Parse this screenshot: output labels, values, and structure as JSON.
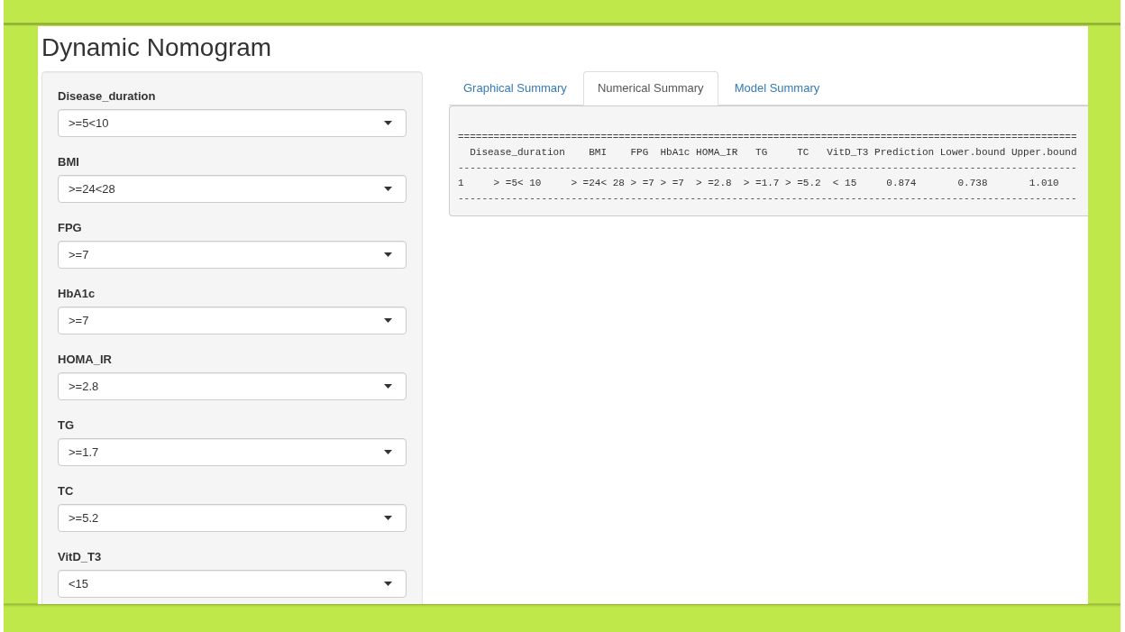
{
  "page": {
    "title": "Dynamic Nomogram"
  },
  "sidebar": {
    "inputs": [
      {
        "label": "Disease_duration",
        "value": ">=5<10"
      },
      {
        "label": "BMI",
        "value": ">=24<28"
      },
      {
        "label": "FPG",
        "value": ">=7"
      },
      {
        "label": "HbA1c",
        "value": ">=7"
      },
      {
        "label": "HOMA_IR",
        "value": ">=2.8"
      },
      {
        "label": "TG",
        "value": ">=1.7"
      },
      {
        "label": "TC",
        "value": ">=5.2"
      },
      {
        "label": "VitD_T3",
        "value": "<15"
      }
    ]
  },
  "tabs": [
    {
      "label": "Graphical Summary",
      "selected": false
    },
    {
      "label": "Numerical Summary",
      "selected": true
    },
    {
      "label": "Model Summary",
      "selected": false
    }
  ],
  "output": {
    "top_rule": "========================================================================================================",
    "header": "  Disease_duration    BMI    FPG  HbA1c HOMA_IR   TG     TC   VitD_T3 Prediction Lower.bound Upper.bound",
    "header_rule": "--------------------------------------------------------------------------------------------------------",
    "rows": [
      "1     > =5< 10     > =24< 28 > =7 > =7  > =2.8  > =1.7 > =5.2  < 15     0.874       0.738       1.010"
    ],
    "bottom_rule": "--------------------------------------------------------------------------------------------------------"
  }
}
